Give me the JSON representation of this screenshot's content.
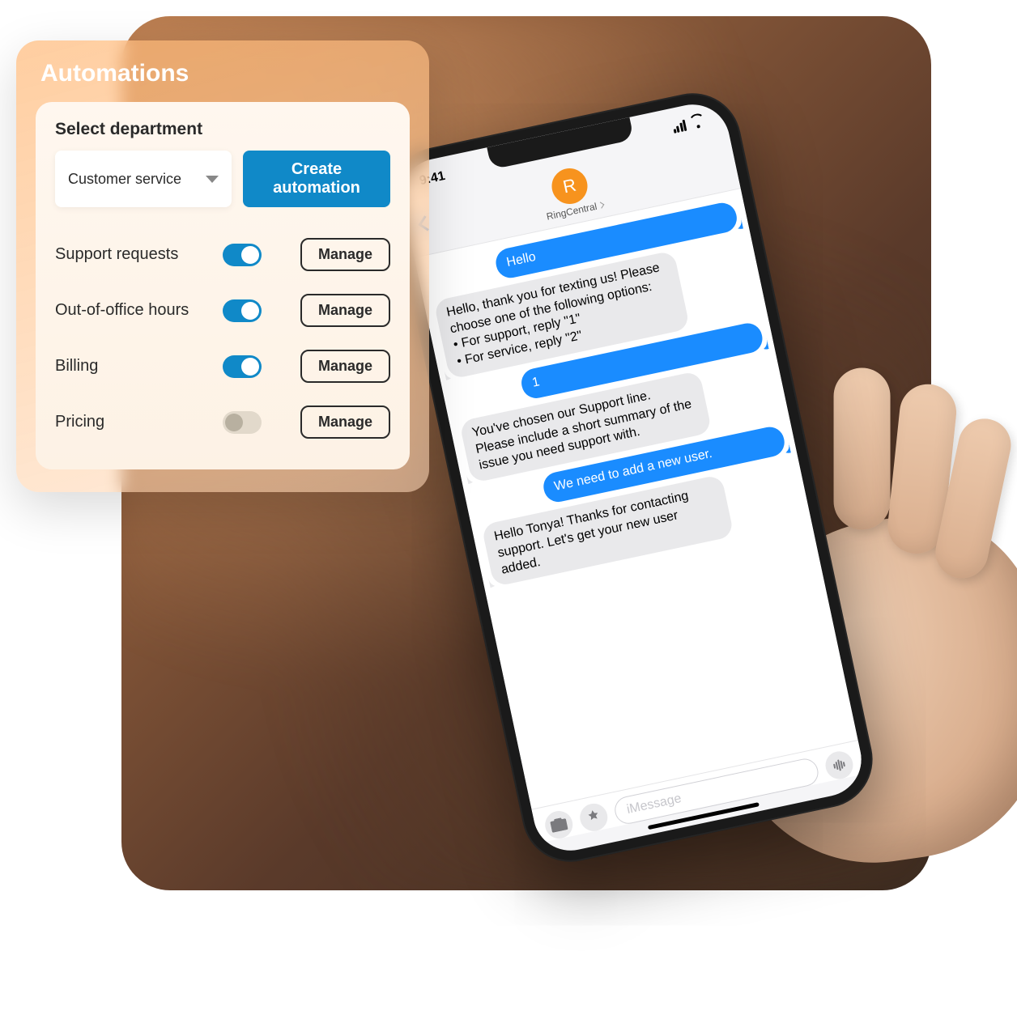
{
  "automations": {
    "title": "Automations",
    "select_label": "Select department",
    "dropdown_value": "Customer service",
    "create_label": "Create automation",
    "manage_label": "Manage",
    "items": [
      {
        "label": "Support requests",
        "enabled": true
      },
      {
        "label": "Out-of-office hours",
        "enabled": true
      },
      {
        "label": "Billing",
        "enabled": true
      },
      {
        "label": "Pricing",
        "enabled": false
      }
    ]
  },
  "phone": {
    "time": "9:41",
    "contact_name": "RingCentral",
    "avatar_letter": "R",
    "input_placeholder": "iMessage",
    "messages": [
      {
        "side": "sent",
        "text": "Hello"
      },
      {
        "side": "recv",
        "text": "Hello, thank you for texting us! Please choose one of the following options:\n• For support, reply \"1\"\n• For service, reply \"2\""
      },
      {
        "side": "sent",
        "text": "1"
      },
      {
        "side": "recv",
        "text": "You've chosen our Support line. Please include a short summary of the issue you need support with."
      },
      {
        "side": "sent",
        "text": "We need to add a new user."
      },
      {
        "side": "recv",
        "text": "Hello Tonya! Thanks for contacting support. Let's get your new user added."
      }
    ]
  },
  "colors": {
    "accent_blue": "#1089c8",
    "ios_blue": "#1a8cff",
    "avatar_orange": "#f7931e"
  }
}
